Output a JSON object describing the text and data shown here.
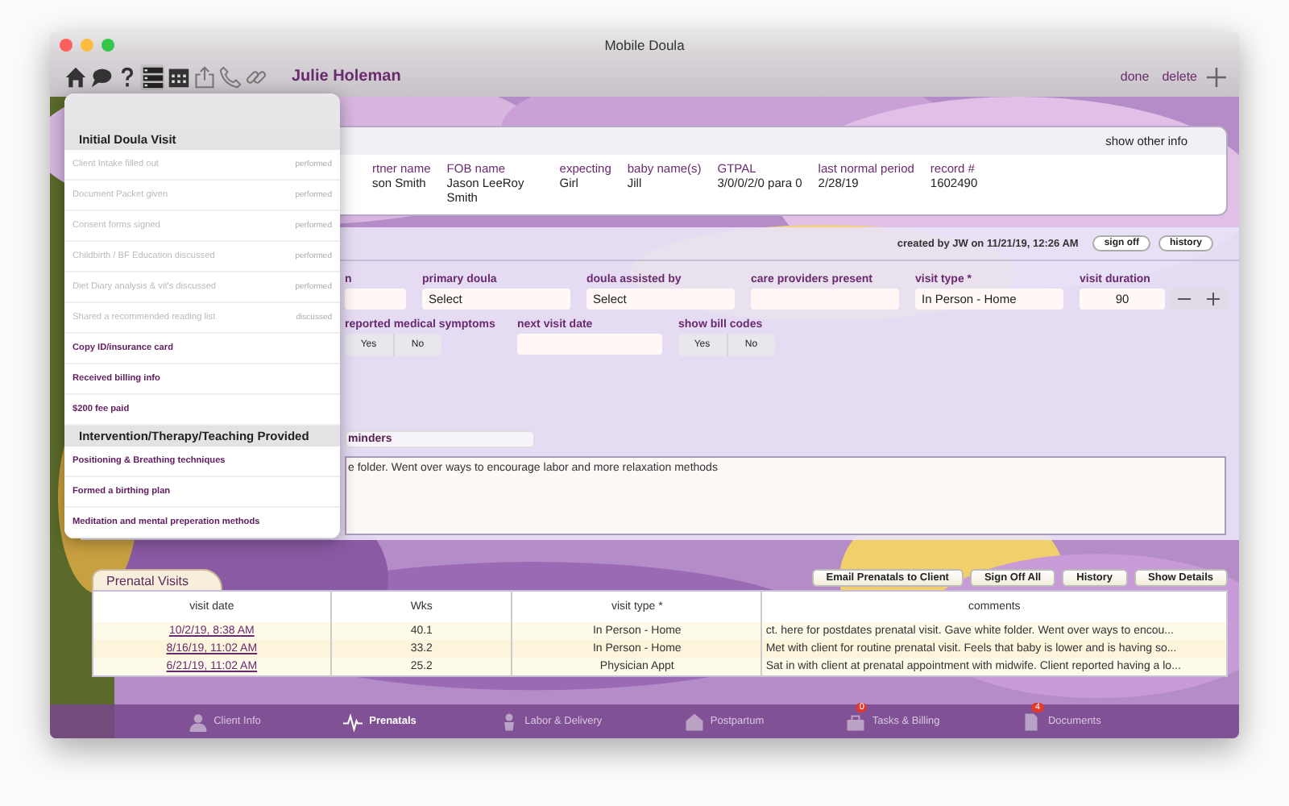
{
  "window": {
    "title": "Mobile Doula"
  },
  "toolbar": {
    "icons": [
      {
        "kind": "home",
        "selected": false,
        "disabled": false
      },
      {
        "kind": "chat",
        "selected": false,
        "disabled": false
      },
      {
        "kind": "question",
        "selected": false,
        "disabled": false
      },
      {
        "kind": "list",
        "selected": true,
        "disabled": false
      },
      {
        "kind": "calendar",
        "selected": false,
        "disabled": false
      },
      {
        "kind": "share",
        "selected": false,
        "disabled": true
      },
      {
        "kind": "phone",
        "selected": false,
        "disabled": true
      },
      {
        "kind": "link",
        "selected": false,
        "disabled": true
      }
    ],
    "client_name": "Julie Holeman",
    "actions": [
      "done",
      "delete"
    ]
  },
  "client_info": {
    "button": "show other info",
    "fields": [
      {
        "label": "rtner name",
        "value": "son Smith"
      },
      {
        "label": "FOB name",
        "value": "Jason LeeRoy Smith"
      },
      {
        "label": "expecting",
        "value": "Girl"
      },
      {
        "label": "baby name(s)",
        "value": "Jill"
      },
      {
        "label": "GTPAL",
        "value": "3/0/0/2/0 para 0"
      },
      {
        "label": "last normal period",
        "value": "2/28/19"
      },
      {
        "label": "record #",
        "value": "1602490"
      }
    ]
  },
  "visit": {
    "created": "created by JW on 11/21/19, 12:26 AM",
    "buttons": [
      "sign off",
      "history"
    ],
    "fields": [
      {
        "kind": "text",
        "label": "n"
      },
      {
        "kind": "select",
        "label": "primary doula",
        "value": "Select"
      },
      {
        "kind": "select",
        "label": "doula assisted by",
        "value": "Select"
      },
      {
        "kind": "text",
        "label": "care providers present"
      },
      {
        "kind": "text",
        "label": "visit type *",
        "value": "In Person - Home"
      },
      {
        "kind": "stepper",
        "label": "visit duration",
        "value": "90"
      }
    ],
    "fields_2": [
      {
        "kind": "toggle",
        "label": "reported medical symptoms",
        "options": [
          "Yes",
          "No"
        ]
      },
      {
        "kind": "text",
        "label": "next visit date"
      },
      {
        "kind": "toggle",
        "label": "show bill codes",
        "options": [
          "Yes",
          "No"
        ]
      }
    ],
    "notes_tab": "minders",
    "notes": "e folder.  Went over ways to encourage labor and more relaxation methods"
  },
  "prenatal_visits": {
    "title": "Prenatal Visits",
    "buttons": [
      "Email Prenatals to Client",
      "Sign Off All",
      "History",
      "Show Details"
    ],
    "table": {
      "columns": [
        "visit date",
        "Wks",
        "visit type *",
        "comments"
      ],
      "rows": [
        [
          "10/2/19, 8:38 AM",
          "40.1",
          "In Person - Home",
          "ct. here for postdates prenatal visit.  Gave white folder.  Went over ways to encou..."
        ],
        [
          "8/16/19, 11:02 AM",
          "33.2",
          "In Person - Home",
          "Met with client for routine prenatal visit.  Feels that baby is lower and is having so..."
        ],
        [
          "6/21/19, 11:02 AM",
          "25.2",
          "Physician Appt",
          "Sat in with client at prenatal appointment with midwife. Client reported having a lo..."
        ]
      ]
    }
  },
  "tab_bar": [
    {
      "label": "Client Info",
      "kind": "person",
      "selected": false
    },
    {
      "label": "Prenatals",
      "kind": "pulse",
      "selected": true
    },
    {
      "label": "Labor & Delivery",
      "kind": "baby",
      "selected": false
    },
    {
      "label": "Postpartum",
      "kind": "house",
      "selected": false
    },
    {
      "label": "Tasks & Billing",
      "kind": "bag",
      "selected": false,
      "badge": "0"
    },
    {
      "label": "Documents",
      "kind": "doc",
      "selected": false,
      "badge": "4"
    }
  ],
  "popup": {
    "sections": [
      {
        "title": "Initial Doula Visit",
        "items": [
          {
            "label": "Client Intake filled out",
            "done": true,
            "status": "performed"
          },
          {
            "label": "Document Packet given",
            "done": true,
            "status": "performed"
          },
          {
            "label": "Consent forms signed",
            "done": true,
            "status": "performed"
          },
          {
            "label": "Childbirth / BF Education discussed",
            "done": true,
            "status": "performed"
          },
          {
            "label": "Diet Diary analysis & vit's discussed",
            "done": true,
            "status": "performed"
          },
          {
            "label": "Shared a recommended reading list",
            "done": true,
            "status": "discussed"
          },
          {
            "label": "Copy ID/insurance card",
            "done": false
          },
          {
            "label": "Received billing info",
            "done": false
          },
          {
            "label": "$200 fee paid",
            "done": false
          }
        ]
      },
      {
        "title": "Intervention/Therapy/Teaching Provided",
        "items": [
          {
            "label": "Positioning & Breathing techniques",
            "done": false
          },
          {
            "label": "Formed a birthing plan",
            "done": false
          },
          {
            "label": "Meditation and mental preperation methods",
            "done": false
          }
        ]
      }
    ]
  }
}
